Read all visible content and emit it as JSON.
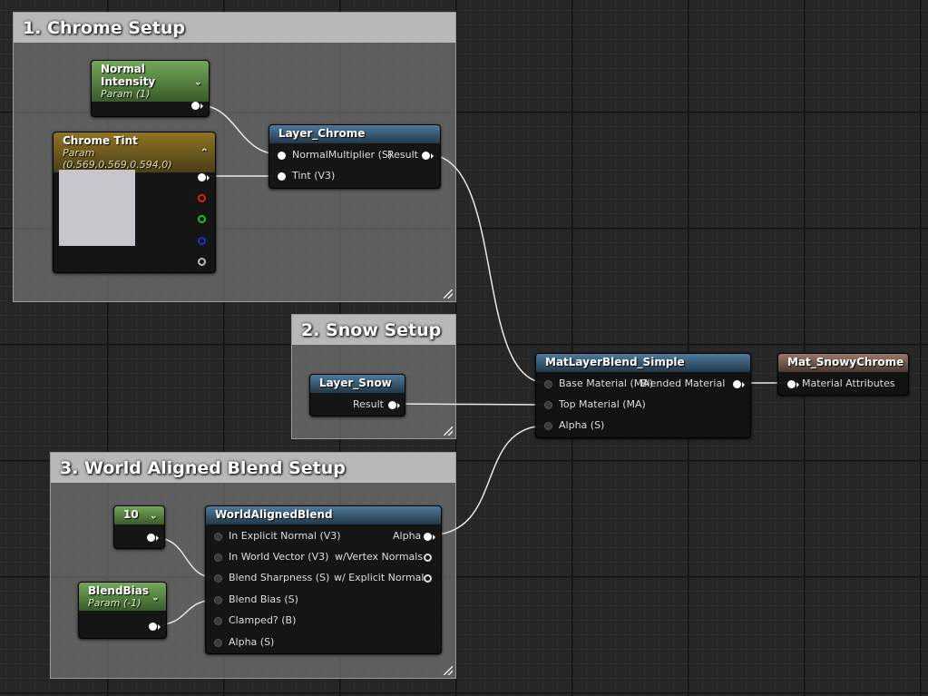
{
  "comments": {
    "chrome": "1. Chrome Setup",
    "snow": "2. Snow Setup",
    "world": "3. World Aligned Blend Setup"
  },
  "nodes": {
    "normal_intensity": {
      "title": "Normal Intensity",
      "subtitle": "Param (1)"
    },
    "chrome_tint": {
      "title": "Chrome Tint",
      "subtitle": "Param (0.569,0.569,0.594,0)",
      "swatch_color": "#c8c6cc"
    },
    "layer_chrome": {
      "title": "Layer_Chrome",
      "in_normal": "NormalMultiplier (S)",
      "out_result": "Result",
      "in_tint": "Tint (V3)"
    },
    "layer_snow": {
      "title": "Layer_Snow",
      "out_result": "Result"
    },
    "matlayerblend": {
      "title": "MatLayerBlend_Simple",
      "in_base": "Base Material (MA)",
      "out_blended": "Blended Material",
      "in_top": "Top Material (MA)",
      "in_alpha": "Alpha (S)"
    },
    "mat_snowy": {
      "title": "Mat_SnowyChrome",
      "in_attr": "Material Attributes"
    },
    "const10": {
      "title": "10"
    },
    "blendbias": {
      "title": "BlendBias",
      "subtitle": "Param (-1)"
    },
    "wab": {
      "title": "WorldAlignedBlend",
      "inputs": [
        "In Explicit Normal (V3)",
        "In World Vector (V3)",
        "Blend Sharpness (S)",
        "Blend Bias (S)",
        "Clamped? (B)",
        "Alpha (S)"
      ],
      "outputs": [
        "Alpha",
        "w/Vertex Normals",
        "w/ Explicit Normal"
      ]
    }
  },
  "colors": {
    "param_green": "#5a8a44",
    "param_gold": "#7a6420",
    "function_blue": "#3c6585",
    "result_brown": "#7c5e50",
    "pin_red": "#e02020",
    "pin_green": "#20c020",
    "pin_blue": "#2030d0"
  },
  "icons": [
    "chevron-down-icon",
    "chevron-up-icon",
    "resize-grip-icon"
  ]
}
